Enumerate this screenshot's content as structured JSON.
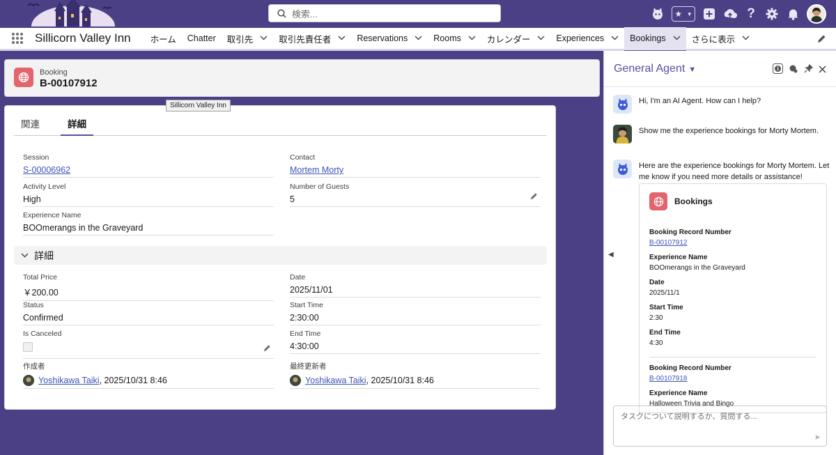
{
  "header": {
    "search_placeholder": "検索...",
    "icons": [
      "agent-icon",
      "favorites-star-icon",
      "add-icon",
      "setup-assistant-icon",
      "help-icon",
      "gear-icon",
      "bell-icon",
      "avatar"
    ]
  },
  "nav": {
    "app_name": "Sillicorn Valley Inn",
    "items": [
      {
        "label": "ホーム",
        "chevron": false
      },
      {
        "label": "Chatter",
        "chevron": false
      },
      {
        "label": "取引先",
        "chevron": true
      },
      {
        "label": "取引先責任者",
        "chevron": true
      },
      {
        "label": "Reservations",
        "chevron": true
      },
      {
        "label": "Rooms",
        "chevron": true
      },
      {
        "label": "カレンダー",
        "chevron": true
      },
      {
        "label": "Experiences",
        "chevron": true
      },
      {
        "label": "Bookings",
        "chevron": true,
        "active": true
      },
      {
        "label": "さらに表示",
        "chevron": true
      }
    ]
  },
  "record": {
    "type": "Booking",
    "name": "B-00107912",
    "tooltip": "Sillicorn Valley Inn"
  },
  "tabs": {
    "related": "関連",
    "details": "詳細"
  },
  "fields": {
    "session": {
      "label": "Session",
      "value": "S-00006962"
    },
    "contact": {
      "label": "Contact",
      "value": "Mortem Morty"
    },
    "activity_level": {
      "label": "Activity Level",
      "value": "High"
    },
    "guests": {
      "label": "Number of Guests",
      "value": "5"
    },
    "experience": {
      "label": "Experience Name",
      "value": "BOOmerangs in the Graveyard"
    },
    "section_title": "詳細",
    "total_price": {
      "label": "Total Price",
      "value": "￥200.00"
    },
    "date": {
      "label": "Date",
      "value": "2025/11/01"
    },
    "status": {
      "label": "Status",
      "value": "Confirmed"
    },
    "start_time": {
      "label": "Start Time",
      "value": "2:30:00"
    },
    "is_canceled": {
      "label": "Is Canceled",
      "checked": false
    },
    "end_time": {
      "label": "End Time",
      "value": "4:30:00"
    },
    "created_by": {
      "label": "作成者",
      "user": "Yoshikawa Taiki",
      "date": ", 2025/10/31 8:46"
    },
    "modified_by": {
      "label": "最終更新者",
      "user": "Yoshikawa Taiki",
      "date": ", 2025/10/31 8:46"
    }
  },
  "agent": {
    "title": "General Agent",
    "messages": [
      {
        "from": "bot",
        "text": "Hi, I'm an AI Agent. How can I help?"
      },
      {
        "from": "user",
        "text": "Show me the experience bookings for Morty Mortem."
      },
      {
        "from": "bot",
        "text": "Here are the experience bookings for Morty Mortem. Let me know if you need more details or assistance!"
      }
    ],
    "card": {
      "title": "Bookings",
      "records": [
        {
          "number_label": "Booking Record Number",
          "number": "B-00107912",
          "exp_label": "Experience Name",
          "exp": "BOOmerangs in the Graveyard",
          "date_label": "Date",
          "date": "2025/11/1",
          "start_label": "Start Time",
          "start": "2:30",
          "end_label": "End Time",
          "end": "4:30"
        },
        {
          "number_label": "Booking Record Number",
          "number": "B-00107918",
          "exp_label": "Experience Name",
          "exp": "Halloween Trivia and Bingo"
        }
      ]
    },
    "input_placeholder": "タスクについて説明するか、質問する..."
  },
  "colors": {
    "brand": "#4b3f86",
    "accent": "#5a4ca0",
    "record_icon": "#e3646d",
    "link": "#3d54b9"
  }
}
